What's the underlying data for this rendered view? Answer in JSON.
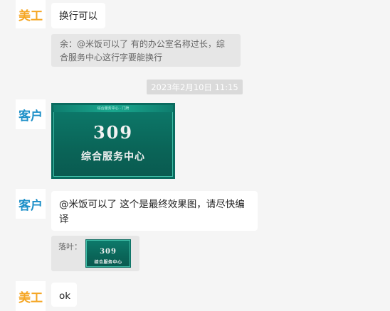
{
  "messages": {
    "m1": {
      "sender": "美工",
      "text": "换行可以"
    },
    "m1_quote": {
      "text": "余：@米饭可以了 有的办公室名称过长，综合服务中心这行字要能换行"
    },
    "timestamp": "2023年2月10日 11:15",
    "m2": {
      "sender": "客户",
      "image": {
        "band_text": "综合服务中心 · 门牌",
        "number": "309",
        "name": "综合服务中心"
      }
    },
    "m3": {
      "sender": "客户",
      "text": "@米饭可以了 这个是最终效果图，请尽快编译"
    },
    "m3_quote": {
      "prefix": "落叶：",
      "image": {
        "number": "309",
        "name": "综合服务中心"
      }
    },
    "m4": {
      "sender": "美工",
      "text": "ok"
    }
  },
  "colors": {
    "background": "#f5f5f5",
    "meigong_name": "#f5a623",
    "kehu_name": "#1e90c8",
    "card_green": "#0a6b5f"
  }
}
